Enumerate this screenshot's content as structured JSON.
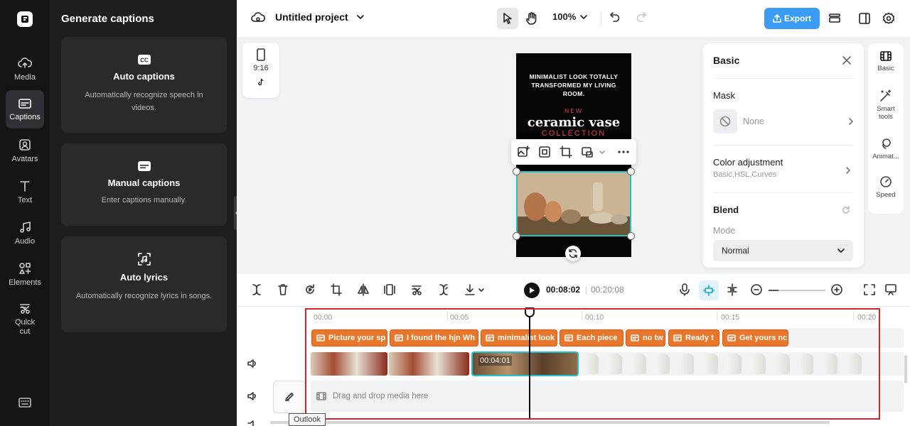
{
  "rail": {
    "items": [
      {
        "label": "Media",
        "icon": "cloud-upload-icon"
      },
      {
        "label": "Captions",
        "icon": "captions-icon"
      },
      {
        "label": "Avatars",
        "icon": "avatar-icon"
      },
      {
        "label": "Text",
        "icon": "text-icon"
      },
      {
        "label": "Audio",
        "icon": "music-note-icon"
      },
      {
        "label": "Elements",
        "icon": "elements-icon"
      },
      {
        "label": "Quick cut",
        "icon": "quick-cut-icon"
      }
    ]
  },
  "panel": {
    "title": "Generate captions",
    "cards": [
      {
        "title": "Auto captions",
        "desc": "Automatically recognize speech in videos."
      },
      {
        "title": "Manual captions",
        "desc": "Enter captions manually."
      },
      {
        "title": "Auto lyrics",
        "desc": "Automatically recognize lyrics in songs."
      }
    ]
  },
  "topbar": {
    "project": "Untitled project",
    "zoom": "100%",
    "export": "Export"
  },
  "canvas": {
    "ratio": "9:16",
    "video": {
      "headline": "MINIMALIST LOOK TOTALLY TRANSFORMED MY LIVING ROOM.",
      "new": "NEW",
      "big": "ceramic vase",
      "collection": "COLLECTION"
    }
  },
  "props": {
    "title": "Basic",
    "mask_title": "Mask",
    "mask_value": "None",
    "color_title": "Color adjustment",
    "color_sub": "Basic,HSL,Curves",
    "blend_title": "Blend",
    "mode_label": "Mode",
    "mode_value": "Normal"
  },
  "tabs": {
    "basic": "Basic",
    "smart": "Smart tools",
    "animate": "Animat...",
    "speed": "Speed"
  },
  "timeline": {
    "current_time": "00:08:02",
    "total_time": "00:20:08",
    "ruler": [
      "00:00",
      "00:05",
      "00:10",
      "00:15",
      "00:20"
    ],
    "captions": [
      "Picture your sp",
      "I found the hjn Wh",
      "minimalist look",
      "Each piece",
      "no tw",
      "Ready t",
      "Get yours nc"
    ],
    "clip_timecode": "00:04:01",
    "drop_text": "Drag and drop media here",
    "tooltip": "Outlook"
  },
  "colors": {
    "accent": "#3a9cf5",
    "selection": "#21c2cf",
    "caption": "#e8772b",
    "highlight": "#d9232a"
  }
}
